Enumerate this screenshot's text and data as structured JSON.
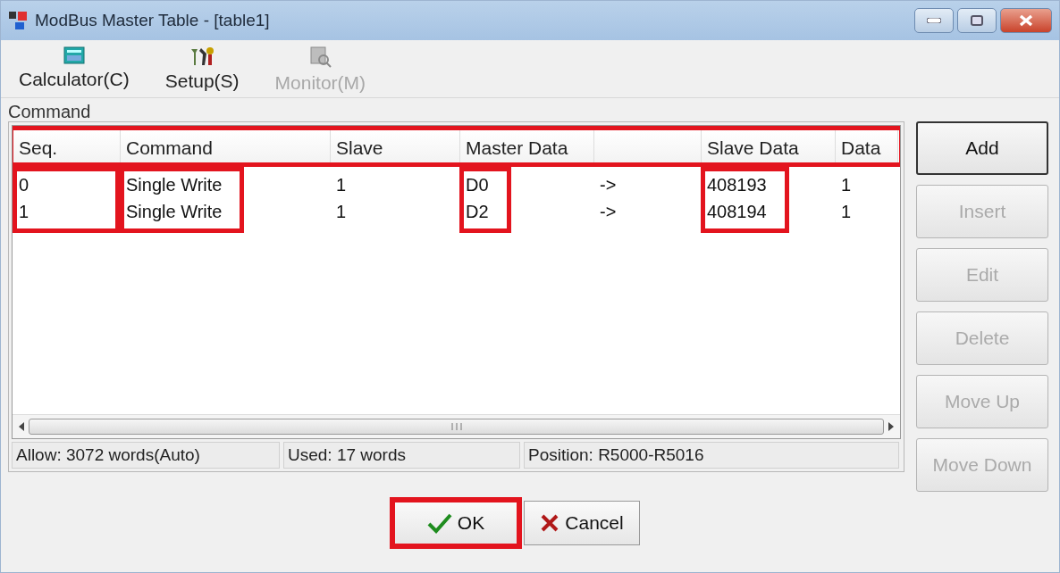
{
  "window": {
    "title": "ModBus Master Table - [table1]"
  },
  "toolbar": [
    {
      "label": "Calculator(C)",
      "kind": "calculator",
      "disabled": false
    },
    {
      "label": "Setup(S)",
      "kind": "setup",
      "disabled": false
    },
    {
      "label": "Monitor(M)",
      "kind": "monitor",
      "disabled": true
    }
  ],
  "group": {
    "title": "Command"
  },
  "table": {
    "header_highlighted": true,
    "columns": [
      {
        "label": "Seq.",
        "highlighted": true
      },
      {
        "label": "Command",
        "highlighted": true
      },
      {
        "label": "Slave",
        "highlighted": false
      },
      {
        "label": "Master Data",
        "highlighted": true
      },
      {
        "highlighted": false
      },
      {
        "label": "Slave Data",
        "highlighted": true
      },
      {
        "label": "Data",
        "highlighted": false
      }
    ],
    "rows": [
      [
        "0",
        "Single Write",
        "1",
        "D0",
        "->",
        "408193",
        "1"
      ],
      [
        "1",
        "Single Write",
        "1",
        "D2",
        "->",
        "408194",
        "1"
      ]
    ]
  },
  "side_buttons": [
    {
      "label": "Add",
      "disabled": false
    },
    {
      "label": "Insert",
      "disabled": true
    },
    {
      "label": "Edit",
      "disabled": true
    },
    {
      "label": "Delete",
      "disabled": true
    },
    {
      "label": "Move Up",
      "disabled": true
    },
    {
      "label": "Move Down",
      "disabled": true
    }
  ],
  "status_bar": [
    "Allow: 3072 words(Auto)",
    "Used: 17 words",
    "Position: R5000-R5016"
  ],
  "footer_buttons": [
    {
      "label": "OK",
      "kind": "ok",
      "highlighted": true
    },
    {
      "label": "Cancel",
      "kind": "cancel",
      "highlighted": false
    }
  ]
}
